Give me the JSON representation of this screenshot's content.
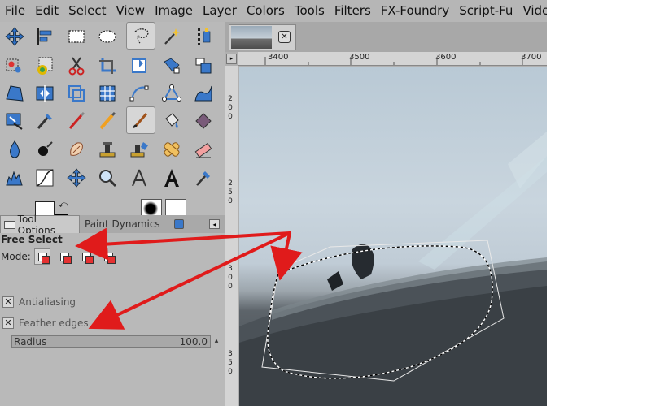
{
  "menubar": {
    "items": [
      "File",
      "Edit",
      "Select",
      "View",
      "Image",
      "Layer",
      "Colors",
      "Tools",
      "Filters",
      "FX-Foundry",
      "Script-Fu",
      "Video"
    ]
  },
  "toolbox": {
    "tools": [
      "move-tool-icon",
      "align-tool-icon",
      "rect-select-icon",
      "ellipse-select-icon",
      "free-select-icon",
      "fuzzy-select-icon",
      "color-select-icon",
      "scissors-select-icon",
      "foreground-select-icon",
      "crop-tool-icon",
      "rotate-tool-icon",
      "scale-tool-icon",
      "shear-tool-icon",
      "perspective-tool-icon",
      "flip-tool-icon",
      "cage-tool-icon",
      "grid-tool-icon",
      "path-tool-icon",
      "measure-tool-icon",
      "warp-tool-icon",
      "text-tool-icon",
      "color-picker-icon",
      "pencil-tool-icon",
      "paintbrush-tool-icon",
      "bucket-fill-icon",
      "blend-tool-icon",
      "eraser-tool-icon",
      "airbrush-tool-icon",
      "ink-tool-icon",
      "clone-tool-icon",
      "perspective-clone-icon",
      "heal-tool-icon",
      "smudge-tool-icon",
      "dodge-burn-icon",
      "blur-sharpen-icon",
      "levels-icon",
      "curves-icon",
      "unified-transform-icon",
      "zoom-tool-icon",
      "compass-tool-icon",
      "text-a-icon",
      "eyedropper-icon"
    ]
  },
  "dock": {
    "tab_tool_options": "Tool Options",
    "tab_paint_dynamics": "Paint Dynamics"
  },
  "tool_options": {
    "title": "Free Select",
    "mode_label": "Mode:",
    "antialiasing_label": "Antialiasing",
    "feather_label": "Feather edges",
    "radius_label": "Radius",
    "radius_value": "100.0"
  },
  "rulers": {
    "h_labels": [
      "3400",
      "3500",
      "3600",
      "3700"
    ],
    "v_labels": [
      [
        "2",
        "0",
        "0"
      ],
      [
        "2",
        "5",
        "0"
      ],
      [
        "3",
        "0",
        "0"
      ],
      [
        "3",
        "5",
        "0"
      ]
    ]
  },
  "colors": {
    "annotation_red": "#e01b1b",
    "menubar_bg": "#b6b6b6"
  }
}
